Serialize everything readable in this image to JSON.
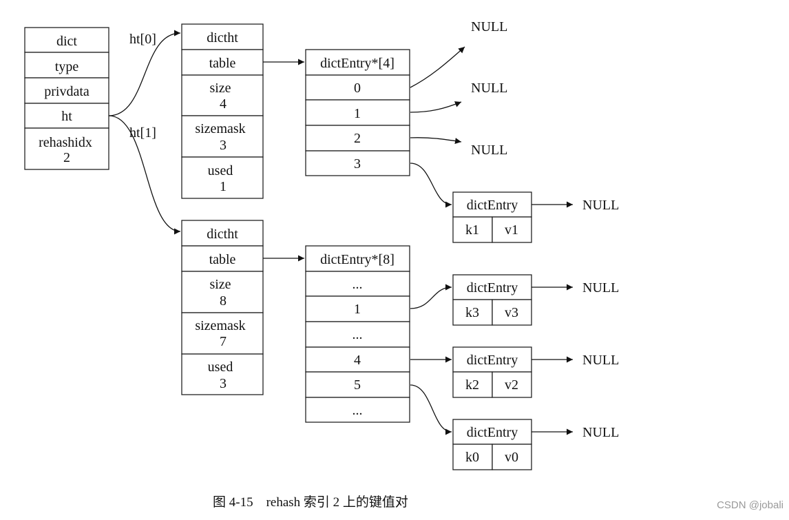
{
  "diagram": {
    "dict": {
      "title": "dict",
      "fields": [
        "type",
        "privdata",
        "ht"
      ],
      "rehashidx": {
        "name": "rehashidx",
        "value": "2"
      }
    },
    "edge_labels": {
      "ht0": "ht[0]",
      "ht1": "ht[1]"
    },
    "ht0": {
      "title": "dictht",
      "table": "table",
      "size": {
        "name": "size",
        "value": "4"
      },
      "sizemask": {
        "name": "sizemask",
        "value": "3"
      },
      "used": {
        "name": "used",
        "value": "1"
      }
    },
    "ht1": {
      "title": "dictht",
      "table": "table",
      "size": {
        "name": "size",
        "value": "8"
      },
      "sizemask": {
        "name": "sizemask",
        "value": "7"
      },
      "used": {
        "name": "used",
        "value": "3"
      }
    },
    "table0": {
      "title": "dictEntry*[4]",
      "slots": [
        "0",
        "1",
        "2",
        "3"
      ]
    },
    "table1": {
      "title": "dictEntry*[8]",
      "slots": [
        "...",
        "1",
        "...",
        "4",
        "5",
        "..."
      ]
    },
    "entries": [
      {
        "title": "dictEntry",
        "key": "k1",
        "value": "v1",
        "next": "NULL"
      },
      {
        "title": "dictEntry",
        "key": "k3",
        "value": "v3",
        "next": "NULL"
      },
      {
        "title": "dictEntry",
        "key": "k2",
        "value": "v2",
        "next": "NULL"
      },
      {
        "title": "dictEntry",
        "key": "k0",
        "value": "v0",
        "next": "NULL"
      }
    ],
    "null_label": "NULL"
  },
  "caption": "图 4-15    rehash 索引 2 上的键值对",
  "watermark": "CSDN @jobali"
}
